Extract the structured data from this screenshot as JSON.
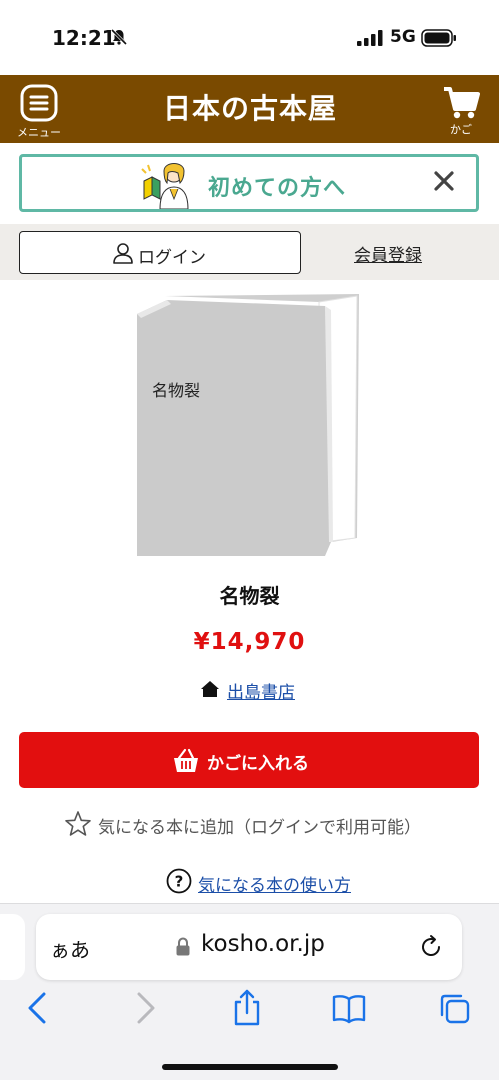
{
  "status_bar": {
    "time": "12:21",
    "network": "5G"
  },
  "header": {
    "menu_label": "メニュー",
    "logo_text": "日本の古本屋",
    "cart_label": "かご"
  },
  "banner": {
    "text": "初めての方へ"
  },
  "login": {
    "login_label": "ログイン",
    "register_label": "会員登録"
  },
  "product": {
    "cover_title": "名物裂",
    "title": "名物裂",
    "price": "¥14,970",
    "store": "出島書店",
    "add_to_cart": "かごに入れる",
    "wishlist": "気になる本に追加（ログインで利用可能）",
    "wishlist_help": "気になる本の使い方"
  },
  "browser": {
    "aa_label": "ぁあ",
    "url": "kosho.or.jp"
  },
  "colors": {
    "header_bg": "#7a4a00",
    "banner_accent": "#5fb8a5",
    "price_red": "#e01010",
    "cart_button": "#e20f0f",
    "link_blue": "#1c4fa8"
  }
}
